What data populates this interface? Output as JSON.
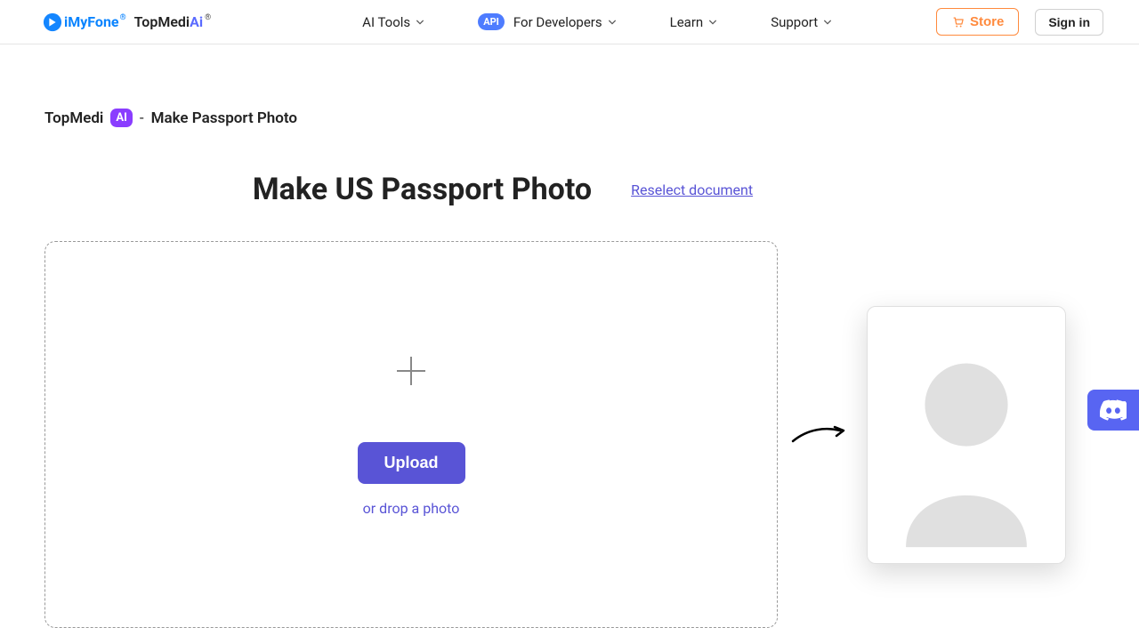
{
  "header": {
    "logo_text_1": "iMyFone",
    "logo_text_2a": "TopMedi",
    "logo_text_2b": "Ai",
    "reg_symbol": "®",
    "nav": {
      "ai_tools": "AI Tools",
      "for_dev_badge": "API",
      "for_dev": "For Developers",
      "learn": "Learn",
      "support": "Support"
    },
    "store_label": "Store",
    "signin_label": "Sign in"
  },
  "breadcrumb": {
    "part1": "TopMedi",
    "ai_badge": "AI",
    "sep": "-",
    "part2": "Make Passport Photo"
  },
  "title": "Make US Passport Photo",
  "reselect_link": "Reselect document",
  "dropzone": {
    "upload_label": "Upload",
    "drop_text": "or drop a photo"
  }
}
